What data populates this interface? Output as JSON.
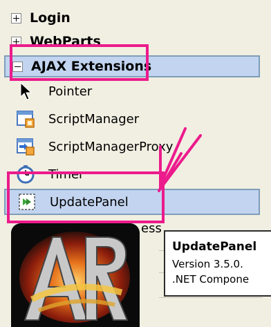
{
  "categories": [
    {
      "label": "Login"
    },
    {
      "label": "WebParts"
    },
    {
      "label": "AJAX Extensions"
    }
  ],
  "items": [
    {
      "label": "Pointer",
      "icon": "pointer-icon"
    },
    {
      "label": "ScriptManager",
      "icon": "script-manager-icon"
    },
    {
      "label": "ScriptManagerProxy",
      "icon": "script-manager-proxy-icon"
    },
    {
      "label": "Timer",
      "icon": "timer-icon"
    },
    {
      "label": "UpdatePanel",
      "icon": "update-panel-icon"
    }
  ],
  "partial_item_text": "ess",
  "tooltip": {
    "title": "UpdatePanel",
    "version": "Version 3.5.0.",
    "component": ".NET Compone"
  },
  "colors": {
    "annotation": "#ec1b8c",
    "selection": "#c2d4ef",
    "panel": "#f1efe2"
  }
}
